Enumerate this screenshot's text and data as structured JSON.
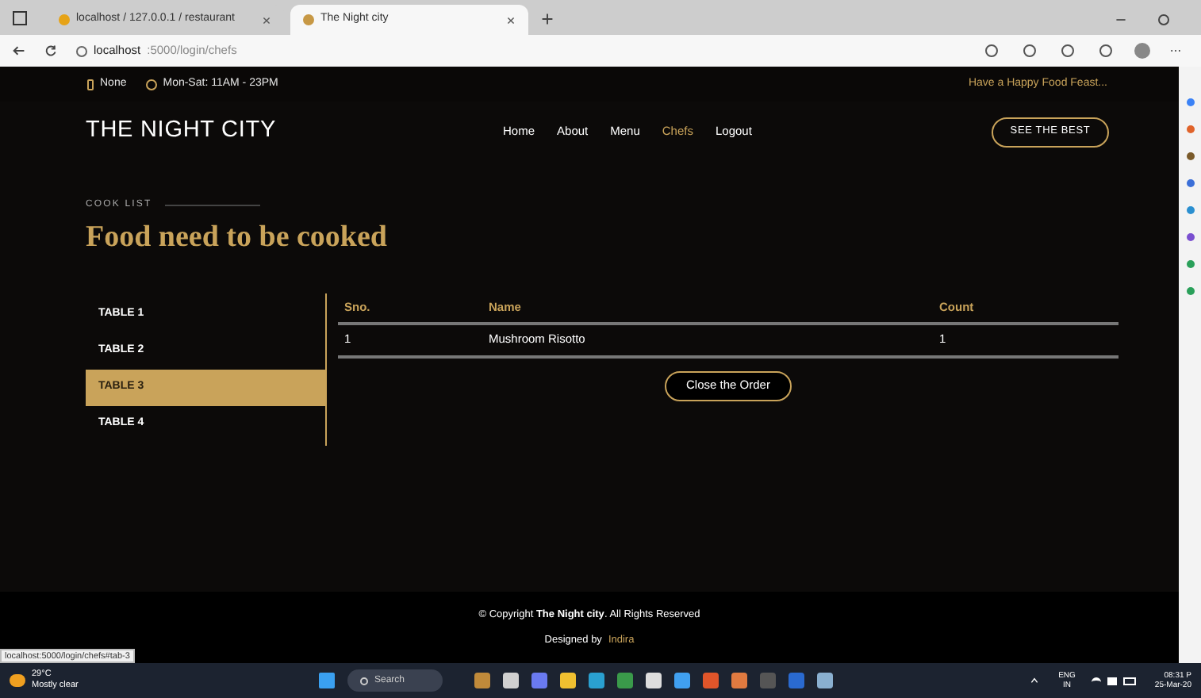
{
  "browser": {
    "tabs": [
      {
        "title": "localhost / 127.0.0.1 / restaurant",
        "selected": false
      },
      {
        "title": "The Night city",
        "selected": true
      }
    ],
    "address": {
      "host": "localhost",
      "path": ":5000/login/chefs"
    },
    "status_url": "localhost:5000/login/chefs#tab-3"
  },
  "topbar": {
    "phone": "None",
    "hours": "Mon-Sat: 11AM - 23PM",
    "tagline": "Have a Happy Food Feast..."
  },
  "header": {
    "logo": "THE NIGHT CITY",
    "nav": [
      {
        "label": "Home",
        "selected": false
      },
      {
        "label": "About",
        "selected": false
      },
      {
        "label": "Menu",
        "selected": false
      },
      {
        "label": "Chefs",
        "selected": true
      },
      {
        "label": "Logout",
        "selected": false
      }
    ],
    "cta": "SEE THE BEST"
  },
  "section": {
    "eyebrow": "COOK LIST",
    "title": "Food need to be cooked"
  },
  "tables": [
    {
      "label": "TABLE 1",
      "selected": false
    },
    {
      "label": "TABLE 2",
      "selected": false
    },
    {
      "label": "TABLE 3",
      "selected": true
    },
    {
      "label": "TABLE 4",
      "selected": false
    }
  ],
  "orders": {
    "columns": [
      "Sno.",
      "Name",
      "Count"
    ],
    "rows": [
      [
        "1",
        "Mushroom Risotto",
        "1"
      ]
    ],
    "button": "Close the Order"
  },
  "footer": {
    "copyright": "© Copyright **The Night city**. All Rights Reserved",
    "designed_prefix": "Designed by",
    "designer": "Indira"
  },
  "taskbar": {
    "weather_temp": "29°C",
    "weather_text": "Mostly clear",
    "search": "Search",
    "lang": "ENG",
    "region": "IN",
    "time": "08:31 P",
    "date": "25-Mar-20"
  }
}
